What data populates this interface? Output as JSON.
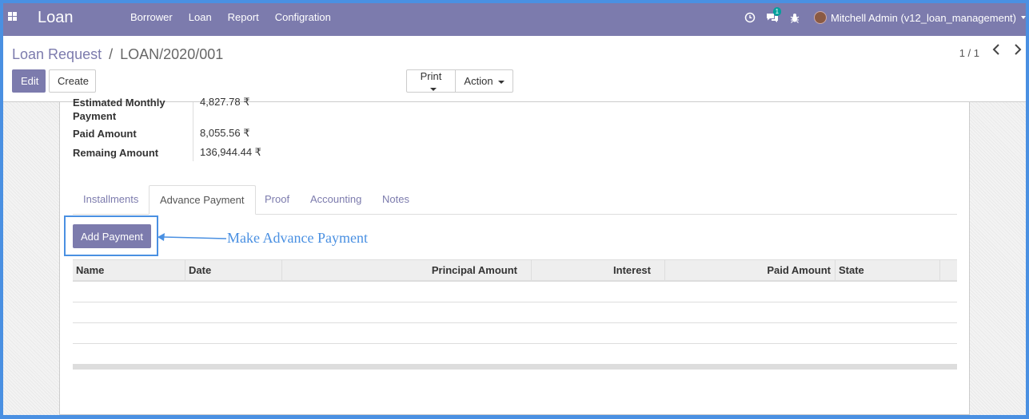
{
  "navbar": {
    "brand": "Loan",
    "menu": [
      "Borrower",
      "Loan",
      "Report",
      "Configration"
    ],
    "chat_badge": "1",
    "user": "Mitchell Admin (v12_loan_management)"
  },
  "breadcrumb": {
    "parent": "Loan Request",
    "separator": "/",
    "current": "LOAN/2020/001"
  },
  "buttons": {
    "edit": "Edit",
    "create": "Create",
    "print": "Print",
    "action": "Action"
  },
  "pager": {
    "value": "1 / 1"
  },
  "fields": {
    "estimated_label": "Estimated Monthly Payment",
    "estimated_value": "4,827.78 ₹",
    "paid_label": "Paid Amount",
    "paid_value": "8,055.56 ₹",
    "remaining_label": "Remaing Amount",
    "remaining_value": "136,944.44 ₹"
  },
  "tabs": [
    "Installments",
    "Advance Payment",
    "Proof",
    "Accounting",
    "Notes"
  ],
  "add_payment": "Add Payment",
  "annotation": "Make Advance Payment",
  "table": {
    "columns": [
      "Name",
      "Date",
      "Principal Amount",
      "Interest",
      "Paid Amount",
      "State"
    ]
  },
  "colors": {
    "brand": "#7c7bad",
    "annotation": "#4a90e2"
  }
}
